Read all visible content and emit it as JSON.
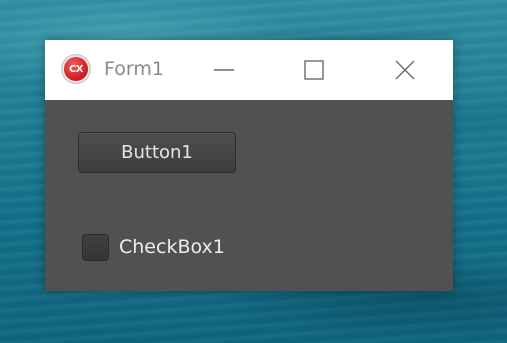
{
  "window": {
    "title": "Form1",
    "icon": {
      "name": "app-icon",
      "text": "CX",
      "color": "#d11f26"
    },
    "controls": {
      "minimize_icon": "minimize-icon",
      "maximize_icon": "maximize-icon",
      "close_icon": "close-icon"
    }
  },
  "form": {
    "background": "#515151",
    "button1_label": "Button1",
    "checkbox1": {
      "label": "CheckBox1",
      "checked": false
    }
  },
  "colors": {
    "titlebar": "#ffffff",
    "title_text": "#8a8a8a",
    "desktop": "#1f7e95"
  }
}
